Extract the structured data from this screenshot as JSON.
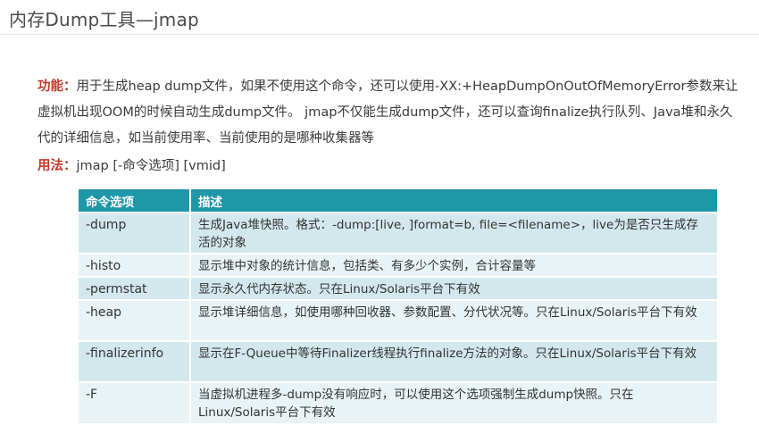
{
  "page": {
    "title": "内存Dump工具—jmap"
  },
  "description": {
    "label": "功能：",
    "text": "用于生成heap dump文件，如果不使用这个命令，还可以使用-XX:+HeapDumpOnOutOfMemoryError参数来让虚拟机出现OOM的时候自动生成dump文件。 jmap不仅能生成dump文件，还可以查询finalize执行队列、Java堆和永久代的详细信息，如当前使用率、当前使用的是哪种收集器等"
  },
  "usage": {
    "label": "用法：",
    "text": "jmap [-命令选项] [vmid]"
  },
  "table": {
    "headers": [
      "命令选项",
      "描述"
    ],
    "rows": [
      {
        "option": "-dump",
        "description": "生成Java堆快照。格式：-dump:[live, ]format=b, file=<filename>，live为是否只生成存活的对象"
      },
      {
        "option": "-histo",
        "description": "显示堆中对象的统计信息，包括类、有多少个实例，合计容量等"
      },
      {
        "option": "-permstat",
        "description": "显示永久代内存状态。只在Linux/Solaris平台下有效"
      },
      {
        "option": "-heap",
        "description": "显示堆详细信息，如使用哪种回收器、参数配置、分代状况等。只在Linux/Solaris平台下有效"
      },
      {
        "option": "-finalizerinfo",
        "description": "显示在F-Queue中等待Finalizer线程执行finalize方法的对象。只在Linux/Solaris平台下有效"
      },
      {
        "option": "-F",
        "description": "当虚拟机进程多-dump没有响应时，可以使用这个选项强制生成dump快照。只在Linux/Solaris平台下有效"
      }
    ]
  }
}
